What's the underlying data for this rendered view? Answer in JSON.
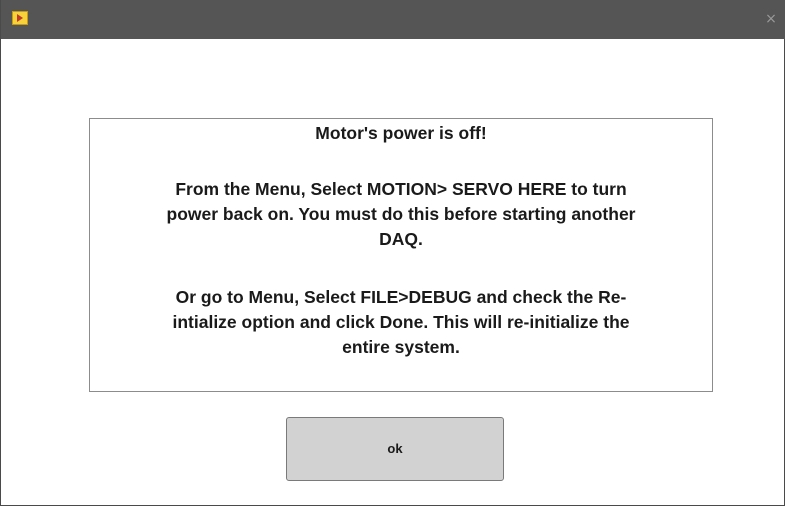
{
  "window": {
    "close_glyph": "×",
    "icon": "labview-app-icon"
  },
  "message": {
    "lines": [
      "Motor's power is off!",
      "From the Menu, Select MOTION> SERVO HERE to turn",
      "power back on.  You must do this before starting another",
      "DAQ.",
      "Or go to Menu, Select FILE>DEBUG and check the Re-",
      "intialize option and click Done.  This will re-initialize the",
      "entire system."
    ]
  },
  "buttons": {
    "ok_label": "ok"
  },
  "colors": {
    "titlebar": "#555555",
    "button_face": "#d2d2d2",
    "text": "#1a1a1a"
  }
}
